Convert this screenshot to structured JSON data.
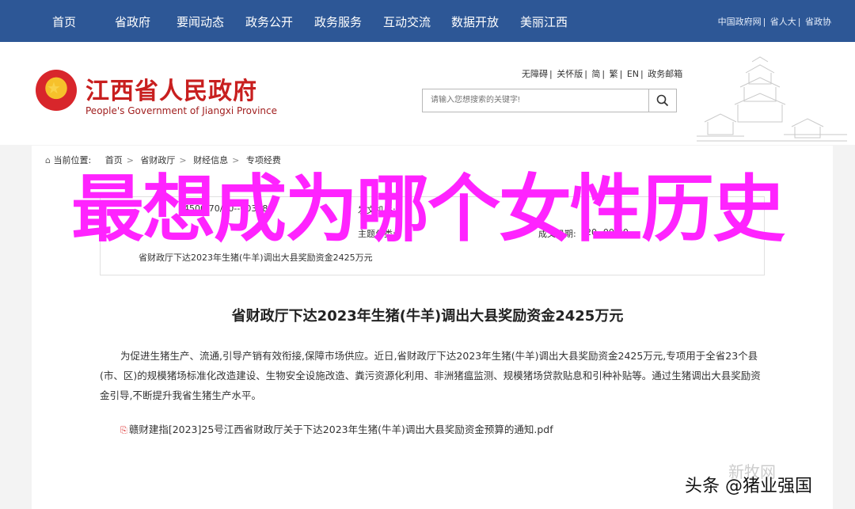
{
  "nav": {
    "items": [
      "首页",
      "省政府",
      "要闻动态",
      "政务公开",
      "政务服务",
      "互动交流",
      "数据开放",
      "美丽江西"
    ],
    "links": [
      "中国政府网",
      "省人大",
      "省政协"
    ]
  },
  "header": {
    "title": "江西省人民政府",
    "subtitle": "People's Government of Jiangxi Province",
    "utilities": [
      "无障碍",
      "关怀版",
      "简",
      "繁",
      "EN",
      "政务邮箱"
    ],
    "search_placeholder": "请输入您想搜索的关键字!"
  },
  "breadcrumb": {
    "label": "当前位置:",
    "items": [
      "首页",
      "省财政厅",
      "财经信息",
      "专项经费"
    ]
  },
  "meta": {
    "index_partial": "4500/70/20--00328",
    "org_label": "发文机关:",
    "category_label": "主题分类:",
    "date_label": "成文日期:",
    "date_partial": "20--00-30",
    "title_partial": "省财政厅下达2023年生猪(牛羊)调出大县奖励资金2425万元"
  },
  "article": {
    "title": "省财政厅下达2023年生猪(牛羊)调出大县奖励资金2425万元",
    "body": "为促进生猪生产、流通,引导产销有效衔接,保障市场供应。近日,省财政厅下达2023年生猪(牛羊)调出大县奖励资金2425万元,专项用于全省23个县(市、区)的规模猪场标准化改造建设、生物安全设施改造、粪污资源化利用、非洲猪瘟监测、规模猪场贷款贴息和引种补贴等。通过生猪调出大县奖励资金引导,不断提升我省生猪生产水平。",
    "attachment": "赣财建指[2023]25号江西省财政厅关于下达2023年生猪(牛羊)调出大县奖励资金预算的通知.pdf"
  },
  "overlay_text": "最想成为哪个女性历史",
  "watermarks": {
    "primary": "新牧网",
    "secondary": "头条 @猪业强国"
  },
  "colors": {
    "nav_bg": "#2d5796",
    "title_red": "#c81f1f",
    "overlay_magenta": "#ff23ff"
  }
}
